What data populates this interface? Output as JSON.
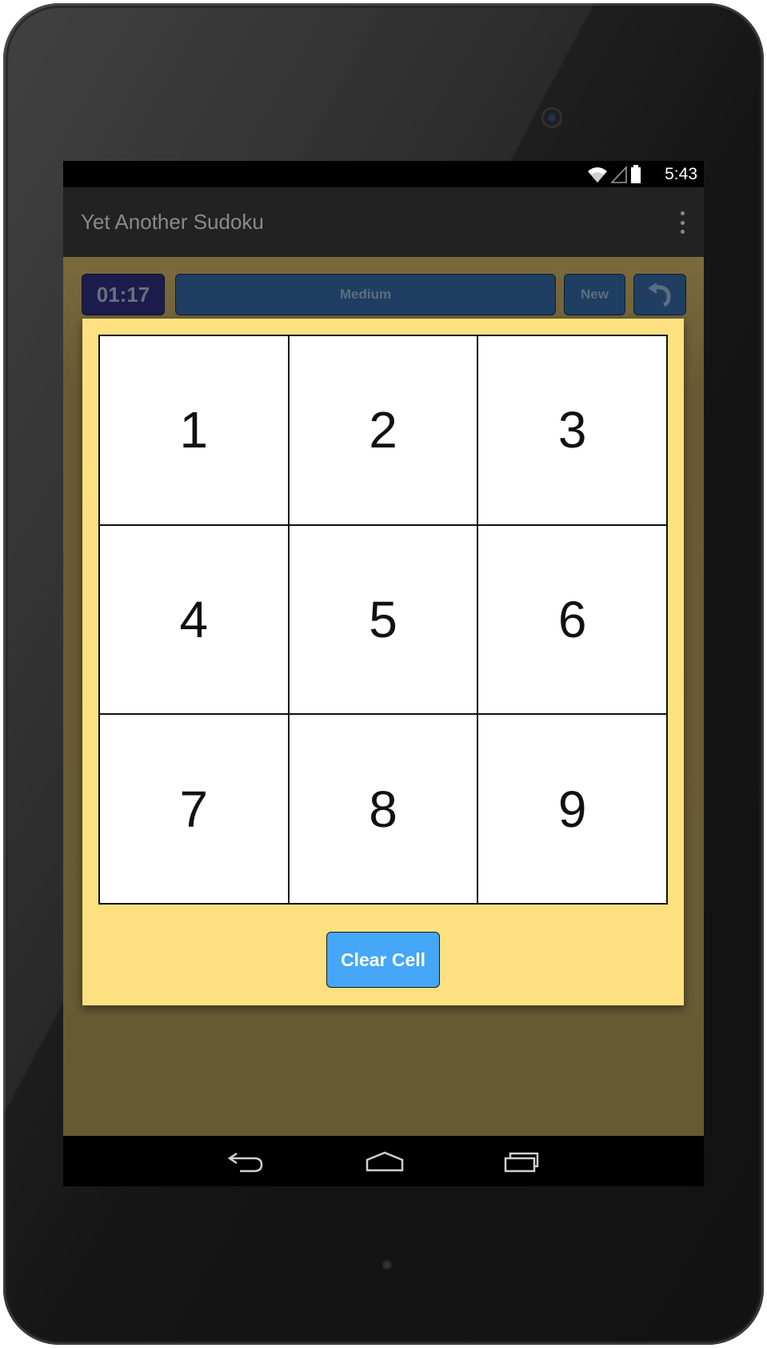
{
  "status_bar": {
    "time": "5:43",
    "icons": [
      "wifi-icon",
      "cell-signal-icon",
      "battery-icon"
    ]
  },
  "action_bar": {
    "title": "Yet Another Sudoku",
    "menu_icon": "overflow-menu-icon"
  },
  "toolbar": {
    "timer": "01:17",
    "difficulty": "Medium",
    "new_label": "New",
    "undo_icon": "undo-icon"
  },
  "number_picker": {
    "numbers": [
      "1",
      "2",
      "3",
      "4",
      "5",
      "6",
      "7",
      "8",
      "9"
    ],
    "clear_label": "Clear Cell"
  },
  "nav_bar": {
    "icons": [
      "back-icon",
      "home-icon",
      "recent-apps-icon"
    ]
  },
  "colors": {
    "board_background": "#675a32",
    "dialog_background": "#fde181",
    "timer_background": "#1c1c4c",
    "toolbar_button": "#1f3e62",
    "clear_button": "#46a6f8"
  }
}
